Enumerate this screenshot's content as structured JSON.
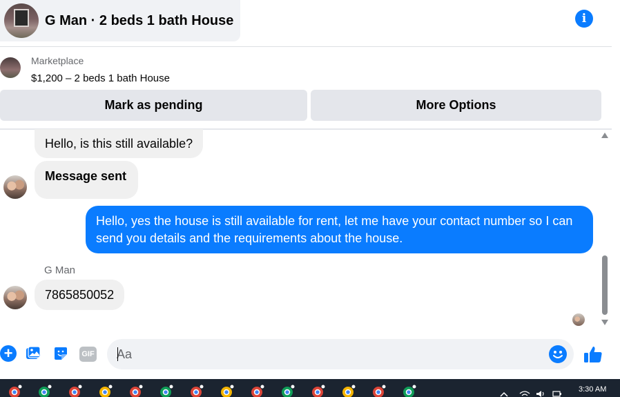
{
  "header": {
    "title": "G Man · 2 beds 1 bath House",
    "avatar_icon": "house-photo",
    "info_icon": "info-icon",
    "info_glyph": "i"
  },
  "listing": {
    "source": "Marketplace",
    "price_title": "$1,200 – 2 beds 1 bath House"
  },
  "actions": {
    "mark_pending": "Mark as pending",
    "more_options": "More Options"
  },
  "messages": {
    "first": "Hello, is this still available?",
    "system": "Message sent",
    "reply": "Hello, yes the house is still available for rent, let me have your contact number so I can send you details and the requirements about the house.",
    "sender_name": "G Man",
    "number": "7865850052"
  },
  "composer": {
    "placeholder": "Aa",
    "plus_glyph": "+",
    "gif_label": "GIF",
    "icons": [
      "plus-icon",
      "image-icon",
      "sticker-icon",
      "gif-icon",
      "emoji-icon",
      "thumbs-up-icon"
    ]
  },
  "taskbar": {
    "time": "3:30 AM"
  },
  "colors": {
    "accent": "#0a7cff",
    "bubble_incoming": "#f0f0f0",
    "button_gray": "#e4e6eb",
    "taskbar": "#1b2430"
  }
}
